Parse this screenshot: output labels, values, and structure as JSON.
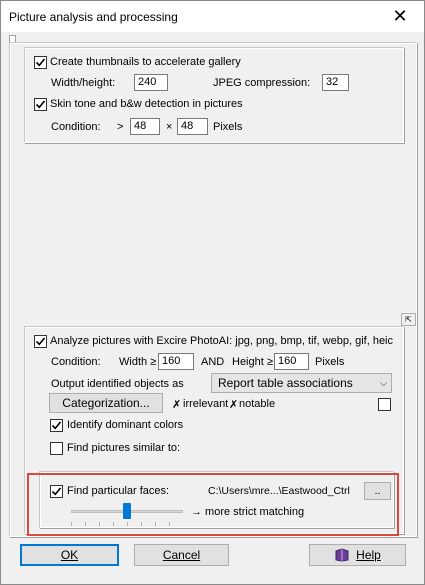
{
  "window": {
    "title": "Picture analysis and processing",
    "close_glyph": "✕"
  },
  "thumbnails": {
    "checkbox_label": "Create thumbnails to accelerate gallery",
    "checked": true,
    "width_label": "Width/height:",
    "width_value": "240",
    "jpeg_label": "JPEG compression:",
    "jpeg_value": "32"
  },
  "skin": {
    "checkbox_label": "Skin tone and b&w detection in pictures",
    "checked": true,
    "condition_label": "Condition:",
    "gt": ">",
    "value1": "48",
    "times": "×",
    "value2": "48",
    "unit": "Pixels"
  },
  "photoai": {
    "checkbox_label": "Analyze pictures with Excire PhotoAI: jpg, png, bmp, tif, webp, gif, heic",
    "checked": true,
    "condition_label": "Condition:",
    "width_label": "Width ≥",
    "width_value": "160",
    "and_label": "AND",
    "height_label": "Height ≥",
    "height_value": "160",
    "unit": "Pixels",
    "output_label": "Output identified objects as",
    "output_value": "Report table associations",
    "categorization_button": "Categorization...",
    "irrelevant_label": "irrelevant",
    "notable_label": "notable",
    "x_glyph": "✗",
    "dominant_label": "Identify dominant colors",
    "dominant_checked": true,
    "similar_label": "Find pictures similar to:",
    "similar_checked": false,
    "small_icon": "⇱"
  },
  "faces": {
    "checkbox_label": "Find particular faces:",
    "checked": true,
    "path": "C:\\Users\\mre...\\Eastwood_Ctrl",
    "browse_button": "..",
    "slider_caption": "→ more strict matching",
    "slider_level": 0.5
  },
  "buttons": {
    "ok": "OK",
    "cancel": "Cancel",
    "help": "Help"
  },
  "colors": {
    "highlight": "#e0483e",
    "accent": "#0078d7",
    "help_icon": "#6a3d9a"
  }
}
